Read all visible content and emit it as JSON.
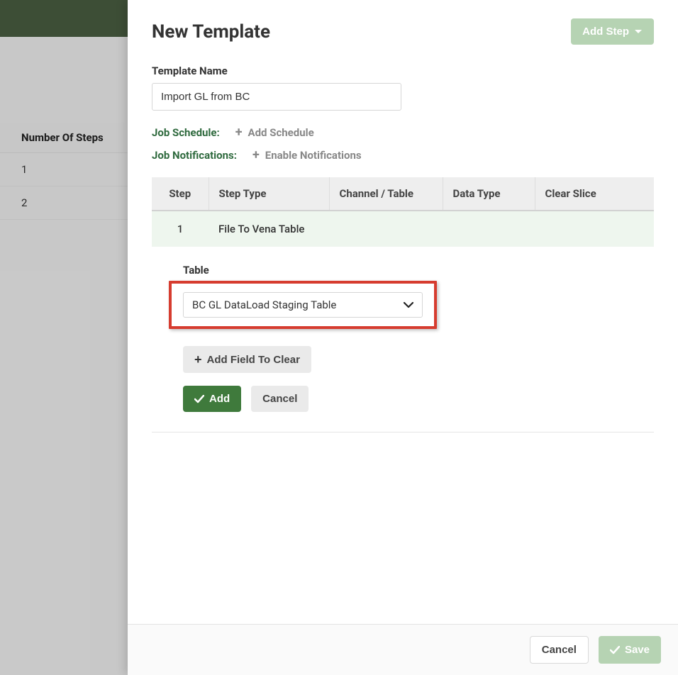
{
  "background": {
    "header_col": "Number Of Steps",
    "rows": [
      "1",
      "2"
    ]
  },
  "panel": {
    "title": "New Template",
    "add_step_label": "Add Step"
  },
  "template_name": {
    "label": "Template Name",
    "value": "Import GL from BC"
  },
  "schedule": {
    "label": "Job Schedule:",
    "action": "Add Schedule"
  },
  "notifications": {
    "label": "Job Notifications:",
    "action": "Enable Notifications"
  },
  "table": {
    "headers": {
      "step": "Step",
      "type": "Step Type",
      "channel": "Channel / Table",
      "data_type": "Data Type",
      "clear_slice": "Clear Slice"
    },
    "rows": [
      {
        "step": "1",
        "type": "File To Vena Table",
        "channel": "",
        "data_type": "",
        "clear_slice": ""
      }
    ]
  },
  "table_select": {
    "label": "Table",
    "value": "BC GL DataLoad Staging Table"
  },
  "buttons": {
    "add_field_to_clear": "Add Field To Clear",
    "add": "Add",
    "cancel_inline": "Cancel",
    "footer_cancel": "Cancel",
    "footer_save": "Save"
  }
}
